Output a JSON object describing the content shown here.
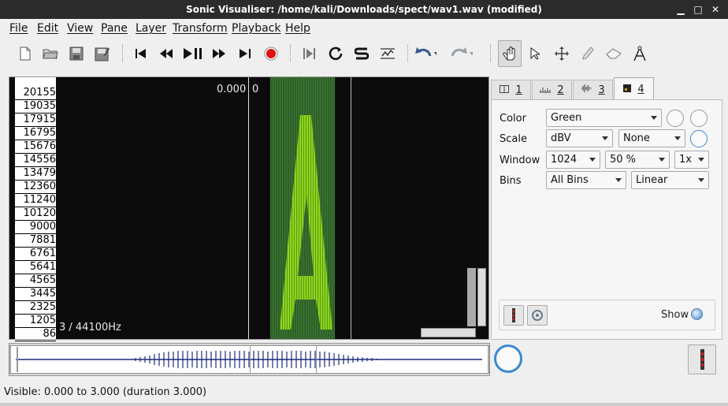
{
  "window": {
    "title": "Sonic Visualiser: /home/kali/Downloads/spect/wav1.wav (modified)",
    "minimize": "▁",
    "maximize": "□",
    "close": "✕"
  },
  "menu": [
    "File",
    "Edit",
    "View",
    "Pane",
    "Layer",
    "Transform",
    "Playback",
    "Help"
  ],
  "toolbar": {
    "icons": [
      "new-file-icon",
      "open-folder-icon",
      "save-icon",
      "save-as-icon",
      "rewind-start-icon",
      "rewind-icon",
      "play-pause-icon",
      "fast-forward-icon",
      "forward-end-icon",
      "record-icon",
      "play-selection-icon",
      "loop-icon",
      "solo-icon",
      "normalize-icon",
      "undo-icon",
      "redo-icon",
      "navigate-hand-icon",
      "select-arrow-icon",
      "move-icon",
      "draw-pencil-icon",
      "erase-icon",
      "measure-icon"
    ]
  },
  "pane": {
    "frequency_ticks": [
      "20155",
      "19035",
      "17915",
      "16795",
      "15676",
      "14556",
      "13479",
      "12360",
      "11240",
      "10120",
      "9000",
      "7881",
      "6761",
      "5641",
      "4565",
      "3445",
      "2325",
      "1205",
      "86"
    ],
    "time_left": "0.000",
    "time_right": "0",
    "layer_info": "3 / 44100Hz",
    "spectrogram_colour": "#7fcf1a"
  },
  "tabs": [
    {
      "label": "1",
      "icon": "pane-icon"
    },
    {
      "label": "2",
      "icon": "ruler-icon"
    },
    {
      "label": "3",
      "icon": "waveform-icon"
    },
    {
      "label": "4",
      "icon": "spectrogram-icon"
    }
  ],
  "properties": {
    "color_label": "Color",
    "color_value": "Green",
    "scale_label": "Scale",
    "scale_value": "dBV",
    "scale_norm": "None",
    "window_label": "Window",
    "window_size": "1024",
    "window_overlap": "50 %",
    "window_oversample": "1x",
    "bins_label": "Bins",
    "bins_value": "All Bins",
    "bins_scale": "Linear",
    "show_label": "Show"
  },
  "status": "Visible: 0.000 to 3.000 (duration 3.000)"
}
